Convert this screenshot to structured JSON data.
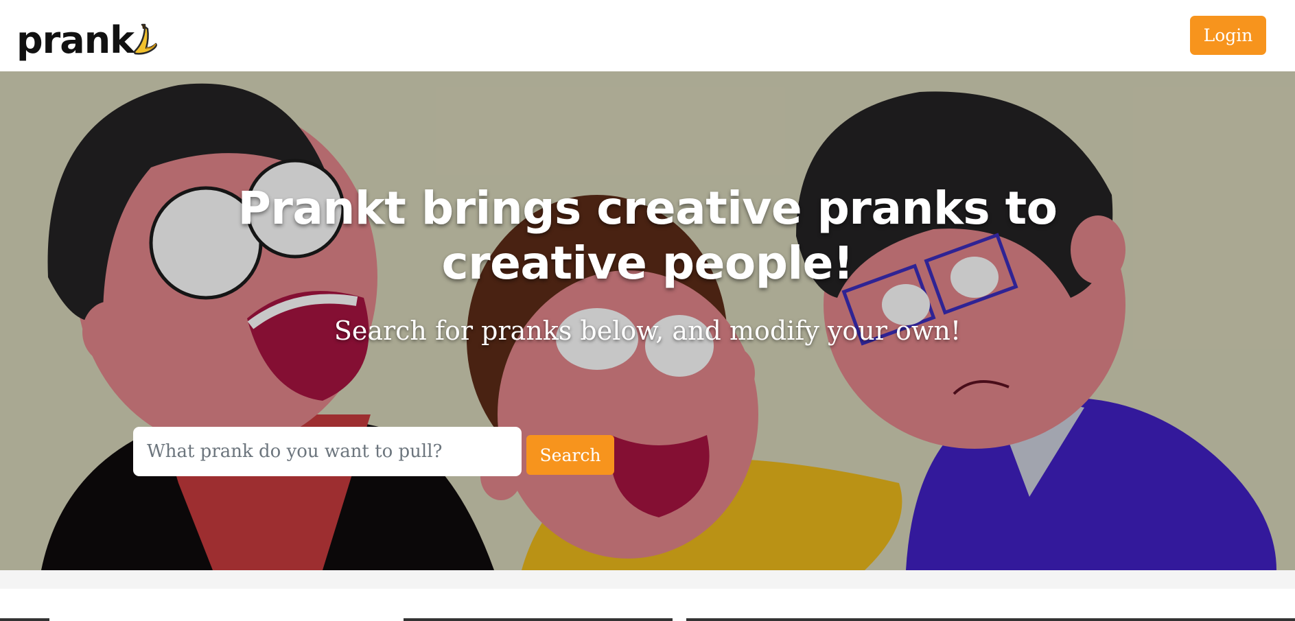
{
  "navbar": {
    "logo_text": "prank",
    "login_label": "Login"
  },
  "hero": {
    "title": "Prankt brings creative pranks to creative people!",
    "subtitle": "Search for pranks below, and modify your own!",
    "search": {
      "placeholder": "What prank do you want to pull?",
      "value": "",
      "button_label": "Search"
    }
  },
  "colors": {
    "accent": "#f7941d",
    "hero_bg": "#b3b29c",
    "navbar_bg": "#ffffff"
  },
  "icons": [
    "banana-icon"
  ]
}
